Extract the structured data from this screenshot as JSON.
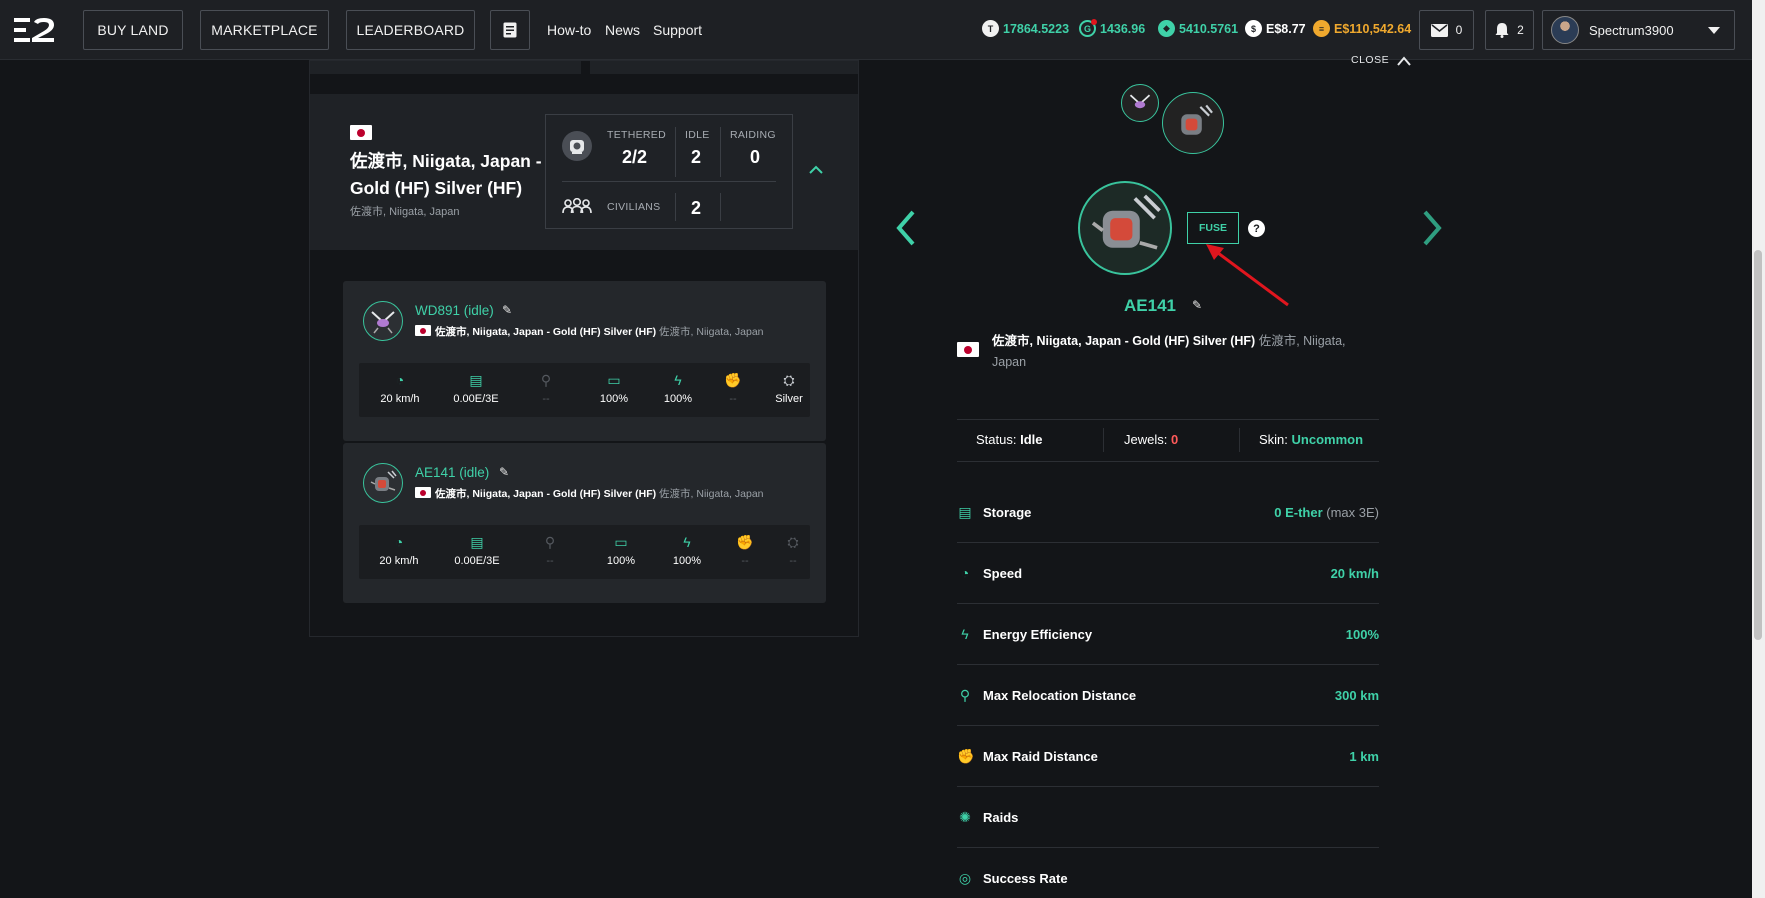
{
  "nav": {
    "buy_land": "BUY LAND",
    "marketplace": "MARKETPLACE",
    "leaderboard": "LEADERBOARD",
    "howto": "How-to",
    "news": "News",
    "support": "Support"
  },
  "balances": {
    "t": "17864.5223",
    "g": "1436.96",
    "e": "5410.5761",
    "dollar": "E$8.77",
    "ether_dollar": "E$110,542.64"
  },
  "mail_count": "0",
  "notif_count": "2",
  "username": "Spectrum3900",
  "land": {
    "title": "佐渡市, Niigata, Japan - Gold (HF) Silver (HF)",
    "subtitle": "佐渡市, Niigata, Japan",
    "stats": {
      "tethered_label": "TETHERED",
      "tethered": "2/2",
      "idle_label": "IDLE",
      "idle": "2",
      "raiding_label": "RAIDING",
      "raiding": "0",
      "civilians_label": "CIVILIANS",
      "civilians": "2"
    }
  },
  "units": [
    {
      "name": "WD891 (idle)",
      "loc_main": "佐渡市, Niigata, Japan - Gold (HF) Silver (HF)",
      "loc_sub": "佐渡市, Niigata, Japan",
      "speed": "20 km/h",
      "storage": "0.00E/3E",
      "relocation": "--",
      "battery": "100%",
      "efficiency": "100%",
      "raid": "--",
      "skin": "Silver"
    },
    {
      "name": "AE141 (idle)",
      "loc_main": "佐渡市, Niigata, Japan - Gold (HF) Silver (HF)",
      "loc_sub": "佐渡市, Niigata, Japan",
      "speed": "20 km/h",
      "storage": "0.00E/3E",
      "relocation": "--",
      "battery": "100%",
      "efficiency": "100%",
      "raid": "--",
      "skin": "--"
    }
  ],
  "detail": {
    "close_label": "CLOSE",
    "fuse_label": "FUSE",
    "help": "?",
    "name": "AE141",
    "loc_main": "佐渡市, Niigata, Japan - Gold (HF) Silver (HF)",
    "loc_sub": "佐渡市, Niigata, Japan",
    "status_label": "Status:",
    "status": "Idle",
    "jewels_label": "Jewels:",
    "jewels": "0",
    "skin_label": "Skin:",
    "skin": "Uncommon",
    "properties": [
      {
        "label": "Storage",
        "value": "0 E-ther",
        "extra": "(max 3E)"
      },
      {
        "label": "Speed",
        "value": "20 km/h",
        "extra": ""
      },
      {
        "label": "Energy Efficiency",
        "value": "100%",
        "extra": ""
      },
      {
        "label": "Max Relocation Distance",
        "value": "300 km",
        "extra": ""
      },
      {
        "label": "Max Raid Distance",
        "value": "1 km",
        "extra": ""
      },
      {
        "label": "Raids",
        "value": "",
        "extra": ""
      },
      {
        "label": "Success Rate",
        "value": "",
        "extra": ""
      }
    ]
  },
  "colors": {
    "accent": "#3fd1a8",
    "background": "#131518",
    "panel": "#1f2226",
    "annotation_arrow": "#e0161e",
    "jewels": "#ff5a5a"
  }
}
